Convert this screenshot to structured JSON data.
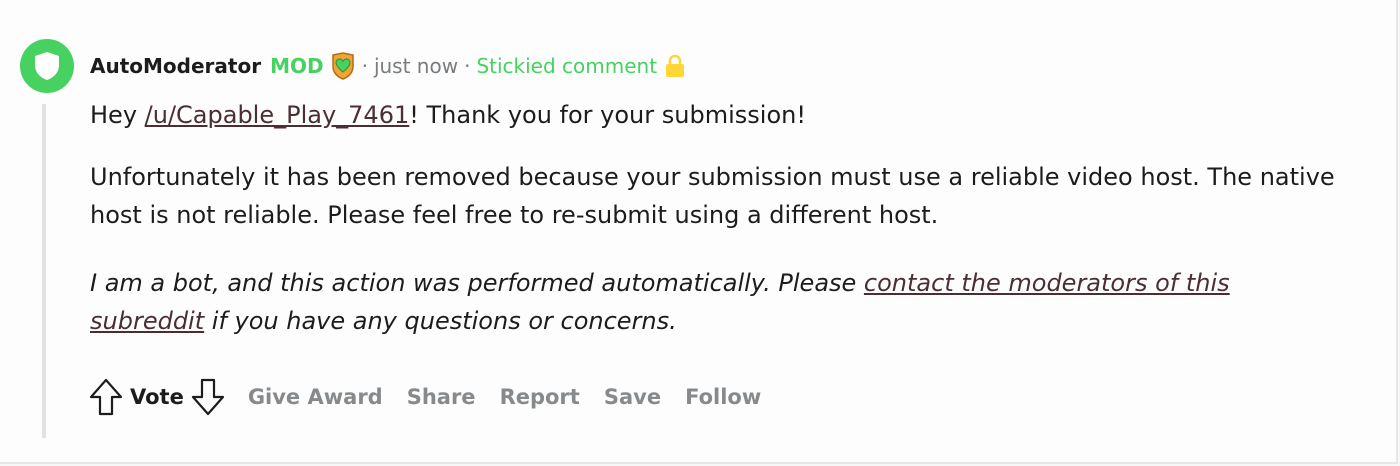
{
  "comment": {
    "author": "AutoModerator",
    "mod_badge": "MOD",
    "separator": "·",
    "time": "just now",
    "sticky_label": "Stickied comment",
    "body": {
      "greeting_prefix": "Hey ",
      "user_link": "/u/Capable_Play_7461",
      "greeting_suffix": "! Thank you for your submission!",
      "removal_notice": "Unfortunately it has been removed because your submission must use a reliable video host. The native host is not reliable. Please feel free to re-submit using a different host.",
      "bot_prefix": "I am a bot, and this action was performed automatically. Please ",
      "contact_link": "contact the moderators of this subreddit",
      "bot_suffix": " if you have any questions or concerns."
    }
  },
  "actions": {
    "vote_label": "Vote",
    "give_award": "Give Award",
    "share": "Share",
    "report": "Report",
    "save": "Save",
    "follow": "Follow"
  },
  "icons": {
    "avatar": "shield-icon",
    "flair": "heart-shield-icon",
    "lock": "lock-icon",
    "upvote": "arrow-up-icon",
    "downvote": "arrow-down-icon"
  },
  "colors": {
    "mod_green": "#46d160",
    "link": "#4b2e33",
    "muted": "#787c7e",
    "lock": "#ffd635"
  }
}
